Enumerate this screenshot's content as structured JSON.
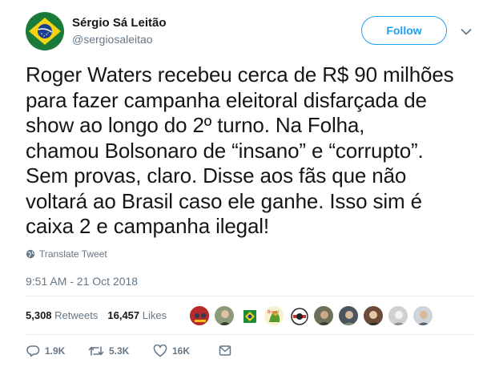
{
  "user": {
    "display_name": "Sérgio Sá Leitão",
    "handle": "@sergiosaleitao",
    "avatar_icon": "brazil-flag-avatar"
  },
  "follow_label": "Follow",
  "tweet": {
    "lines": [
      "Roger Waters recebeu cerca de R$ 90 milhões",
      "para fazer campanha eleitoral disfarçada de",
      "show ao longo do 2º turno. Na Folha,",
      "chamou Bolsonaro de “insano” e “corrupto”.",
      "Sem provas, claro. Disse aos fãs que não",
      "voltará ao Brasil caso ele ganhe. Isso sim é",
      "caixa 2 e campanha ilegal!"
    ],
    "translate_label": "Translate Tweet",
    "timestamp": "9:51 AM - 21 Oct 2018"
  },
  "stats": {
    "retweets_count": "5,308",
    "retweets_label": "Retweets",
    "likes_count": "16,457",
    "likes_label": "Likes"
  },
  "liker_avatars": 10,
  "actions": {
    "replies": "1.9K",
    "retweets": "5.3K",
    "likes": "16K"
  },
  "colors": {
    "accent": "#1da1f2",
    "secondary_text": "#657786",
    "primary_text": "#14171a",
    "divider": "#e6ecf0"
  }
}
